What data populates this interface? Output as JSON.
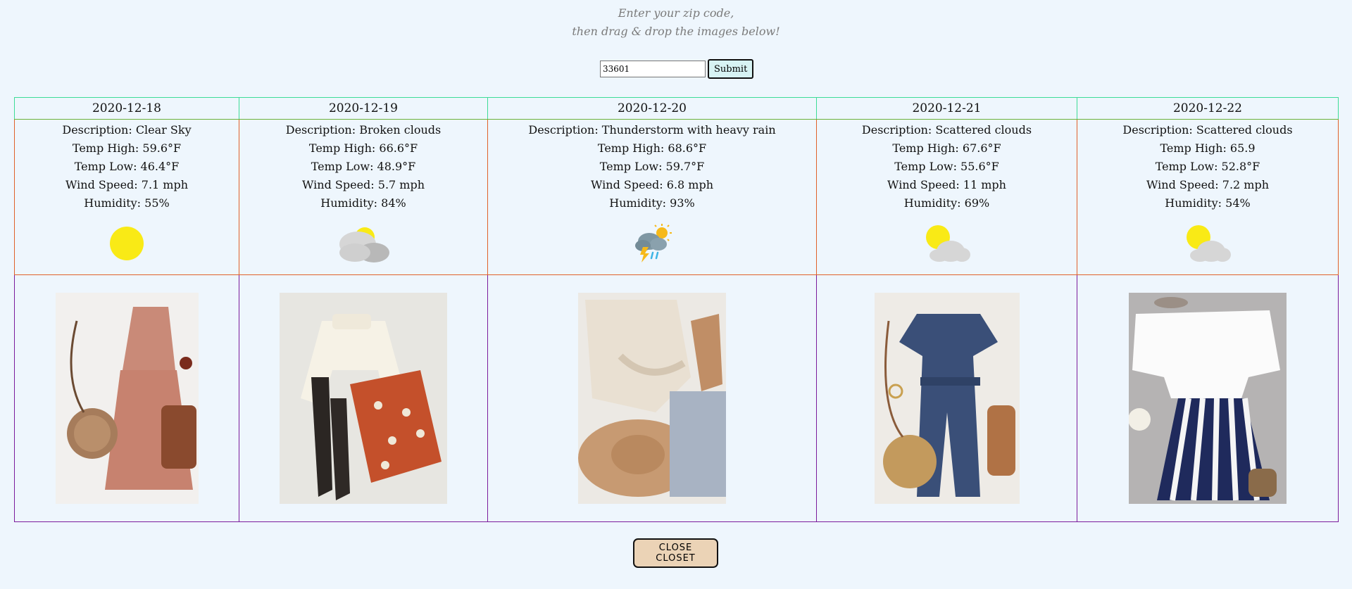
{
  "instructions": {
    "line1": "Enter your zip code,",
    "line2": "then drag & drop the images below!"
  },
  "zip_form": {
    "value": "33601",
    "submit_label": "Submit"
  },
  "days": [
    {
      "date": "2020-12-18",
      "description": "Description: Clear Sky",
      "temp_high": "Temp High: 59.6°F",
      "temp_low": "Temp Low: 46.4°F",
      "wind": "Wind Speed: 7.1 mph",
      "humidity": "Humidity: 55%",
      "icon": "sun-icon"
    },
    {
      "date": "2020-12-19",
      "description": "Description: Broken clouds",
      "temp_high": "Temp High: 66.6°F",
      "temp_low": "Temp Low: 48.9°F",
      "wind": "Wind Speed: 5.7 mph",
      "humidity": "Humidity: 84%",
      "icon": "broken-clouds-icon"
    },
    {
      "date": "2020-12-20",
      "description": "Description: Thunderstorm with heavy rain",
      "temp_high": "Temp High: 68.6°F",
      "temp_low": "Temp Low: 59.7°F",
      "wind": "Wind Speed: 6.8 mph",
      "humidity": "Humidity: 93%",
      "icon": "thunderstorm-icon"
    },
    {
      "date": "2020-12-21",
      "description": "Description: Scattered clouds",
      "temp_high": "Temp High: 67.6°F",
      "temp_low": "Temp Low: 55.6°F",
      "wind": "Wind Speed: 11 mph",
      "humidity": "Humidity: 69%",
      "icon": "scattered-clouds-icon"
    },
    {
      "date": "2020-12-22",
      "description": "Description: Scattered clouds",
      "temp_high": "Temp High: 65.9",
      "temp_low": "Temp Low: 52.8°F",
      "wind": "Wind Speed: 7.2 mph",
      "humidity": "Humidity: 54%",
      "icon": "scattered-clouds-icon"
    }
  ],
  "outfits": [
    {
      "icon": "outfit-pink-dress-image"
    },
    {
      "icon": "outfit-sweater-skirt-image"
    },
    {
      "icon": "outfit-knit-sweater-jeans-image"
    },
    {
      "icon": "outfit-denim-jumpsuit-image"
    },
    {
      "icon": "outfit-striped-pants-image"
    }
  ],
  "close_label": "CLOSE CLOSET",
  "colors": {
    "background": "#eef6fd",
    "date_border": "#3ddc97",
    "weather_border": "#e0612a",
    "outfit_border": "#7b1c9c",
    "close_button": "#ebd3b6",
    "submit_button": "#d7f3f3",
    "sun": "#f9ea16"
  }
}
